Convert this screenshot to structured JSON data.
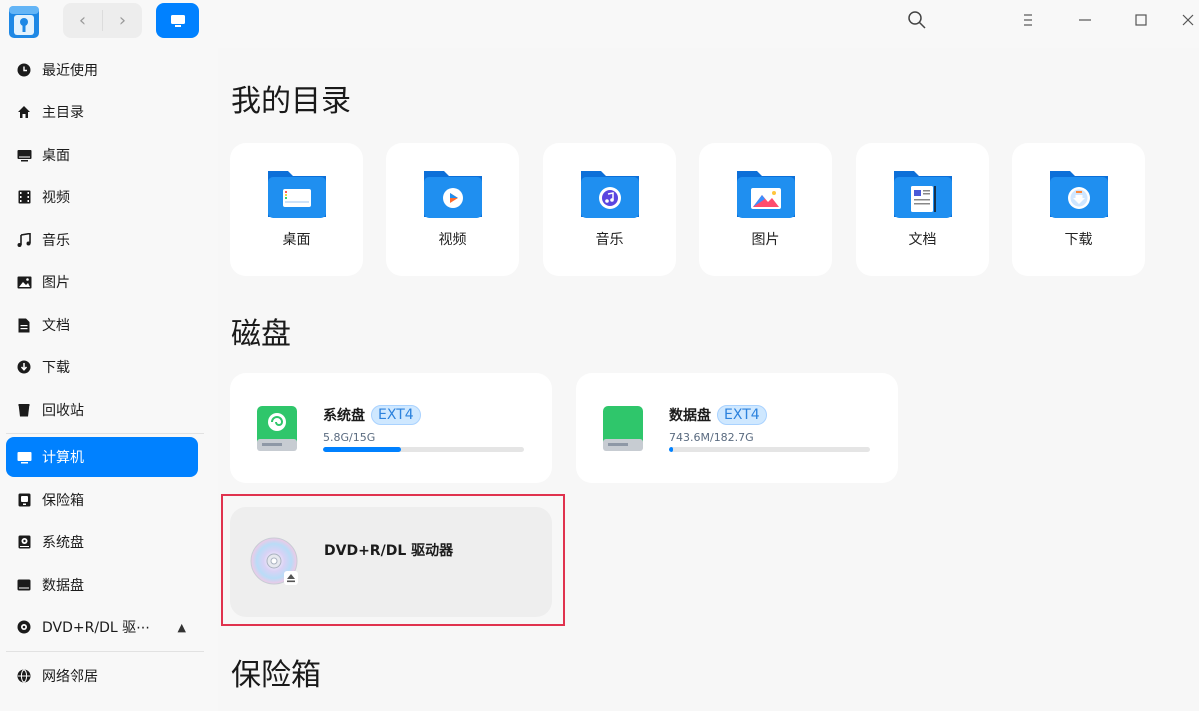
{
  "window": {
    "nav_back": "‹",
    "nav_forward": "›"
  },
  "sidebar": {
    "items": [
      {
        "label": "最近使用",
        "icon": "clock-icon"
      },
      {
        "label": "主目录",
        "icon": "home-icon"
      },
      {
        "label": "桌面",
        "icon": "desktop-icon"
      },
      {
        "label": "视频",
        "icon": "film-icon"
      },
      {
        "label": "音乐",
        "icon": "music-note-icon"
      },
      {
        "label": "图片",
        "icon": "picture-icon"
      },
      {
        "label": "文档",
        "icon": "document-icon"
      },
      {
        "label": "下载",
        "icon": "download-icon"
      },
      {
        "label": "回收站",
        "icon": "trash-icon"
      },
      {
        "label": "计算机",
        "icon": "computer-icon",
        "active": true
      },
      {
        "label": "保险箱",
        "icon": "vault-icon"
      },
      {
        "label": "系统盘",
        "icon": "system-disk-icon"
      },
      {
        "label": "数据盘",
        "icon": "data-disk-icon"
      },
      {
        "label": "DVD+R/DL 驱⋯",
        "icon": "disc-icon",
        "eject": "▲"
      },
      {
        "label": "网络邻居",
        "icon": "network-icon"
      }
    ]
  },
  "main": {
    "my_dirs_title": "我的目录",
    "disks_title": "磁盘",
    "vault_title": "保险箱",
    "dirs": [
      {
        "label": "桌面",
        "icon": "desktop-folder-icon"
      },
      {
        "label": "视频",
        "icon": "video-folder-icon"
      },
      {
        "label": "音乐",
        "icon": "music-folder-icon"
      },
      {
        "label": "图片",
        "icon": "pictures-folder-icon"
      },
      {
        "label": "文档",
        "icon": "documents-folder-icon"
      },
      {
        "label": "下载",
        "icon": "downloads-folder-icon"
      }
    ],
    "disks": [
      {
        "name": "系统盘",
        "fs": "EXT4",
        "size": "5.8G/15G",
        "usage": 0.39
      },
      {
        "name": "数据盘",
        "fs": "EXT4",
        "size": "743.6M/182.7G",
        "usage": 0.01
      }
    ],
    "dvd": {
      "name": "DVD+R/DL 驱动器"
    }
  },
  "colors": {
    "accent": "#0081ff",
    "highlight": "#e0324e",
    "badge_bg": "#cfe8ff"
  }
}
